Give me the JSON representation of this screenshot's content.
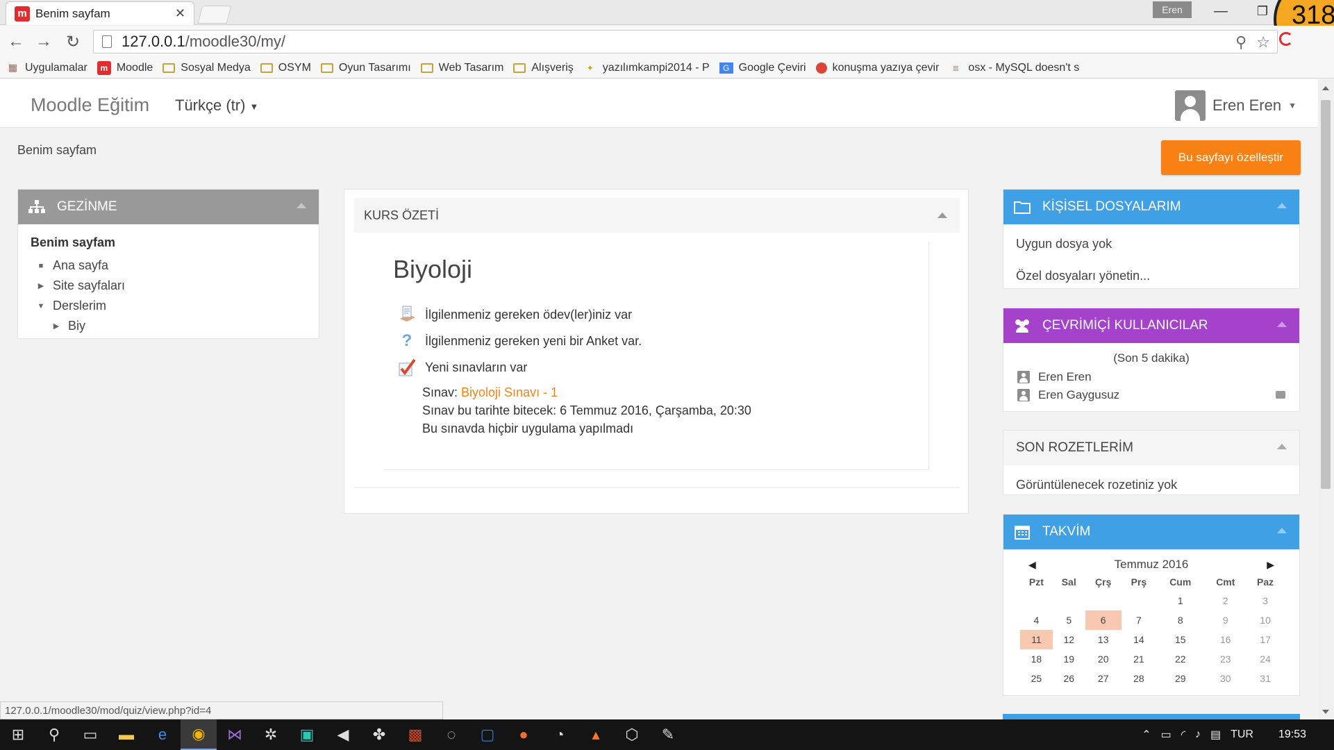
{
  "browser": {
    "tab_title": "Benim sayfam",
    "tab_close": "✕",
    "favicon_letter": "m",
    "profile_label": "Eren",
    "counter_badge": "318",
    "url_host": "127.0.0.1",
    "url_path": "/moodle30/my/",
    "bookmarks": [
      {
        "label": "Uygulamalar",
        "icon": "apps-grid-icon"
      },
      {
        "label": "Moodle",
        "icon": "moodle-icon"
      },
      {
        "label": "Sosyal Medya",
        "icon": "folder-icon"
      },
      {
        "label": "OSYM",
        "icon": "folder-icon"
      },
      {
        "label": "Oyun Tasarımı",
        "icon": "folder-icon"
      },
      {
        "label": "Web Tasarım",
        "icon": "folder-icon"
      },
      {
        "label": "Alışveriş",
        "icon": "folder-icon"
      },
      {
        "label": "yazılımkampi2014 - P",
        "icon": "bee-icon"
      },
      {
        "label": "Google Çeviri",
        "icon": "translate-icon"
      },
      {
        "label": "konuşma yazıya çevir",
        "icon": "chrome-icon"
      },
      {
        "label": "osx - MySQL doesn't s",
        "icon": "stack-icon"
      }
    ]
  },
  "navbar": {
    "brand": "Moodle Eğitim",
    "language": "Türkçe (tr)",
    "user_name": "Eren Eren"
  },
  "page": {
    "breadcrumb": "Benim sayfam",
    "customize_button": "Bu sayfayı özelleştir"
  },
  "nav_block": {
    "title": "GEZİNME",
    "root": "Benim sayfam",
    "items": [
      {
        "label": "Ana sayfa",
        "marker": "■"
      },
      {
        "label": "Site sayfaları",
        "marker": "▶"
      },
      {
        "label": "Derslerim",
        "marker": "▼"
      },
      {
        "label": "Biy",
        "marker": "▶"
      }
    ]
  },
  "course_block": {
    "title": "KURS ÖZETİ",
    "course_name": "Biyoloji",
    "notices": [
      {
        "text": "İlgilenmeniz gereken ödev(ler)iniz var",
        "icon": "assignment-icon"
      },
      {
        "text": "İlgilenmeniz gereken yeni bir Anket var.",
        "icon": "question-icon"
      },
      {
        "text": "Yeni sınavların var",
        "icon": "quiz-check-icon"
      }
    ],
    "quiz_prefix": "Sınav: ",
    "quiz_link": "Biyoloji Sınavı - 1",
    "quiz_deadline": "Sınav bu tarihte bitecek: 6 Temmuz 2016, Çarşamba, 20:30",
    "quiz_attempts": "Bu sınavda hiçbir uygulama yapılmadı"
  },
  "files_block": {
    "title": "KİŞİSEL DOSYALARIM",
    "empty": "Uygun dosya yok",
    "manage": "Özel dosyaları yönetin..."
  },
  "online_block": {
    "title": "ÇEVRİMİÇİ KULLANICILAR",
    "subtitle": "(Son 5 dakika)",
    "users": [
      "Eren Eren",
      "Eren Gaygusuz"
    ]
  },
  "badges_block": {
    "title": "SON ROZETLERİM",
    "empty": "Görüntülenecek rozetiniz yok"
  },
  "calendar": {
    "title": "TAKVİM",
    "month": "Temmuz 2016",
    "prev": "◀",
    "next": "▶",
    "weekdays": [
      "Pzt",
      "Sal",
      "Çrş",
      "Prş",
      "Cum",
      "Cmt",
      "Paz"
    ],
    "weeks": [
      [
        "",
        "",
        "",
        "",
        "1",
        "2",
        "3"
      ],
      [
        "4",
        "5",
        "6",
        "7",
        "8",
        "9",
        "10"
      ],
      [
        "11",
        "12",
        "13",
        "14",
        "15",
        "16",
        "17"
      ],
      [
        "18",
        "19",
        "20",
        "21",
        "22",
        "23",
        "24"
      ],
      [
        "25",
        "26",
        "27",
        "28",
        "29",
        "30",
        "31"
      ]
    ],
    "event_day": "6",
    "today": "11"
  },
  "status_url": "127.0.0.1/moodle30/mod/quiz/view.php?id=4",
  "taskbar": {
    "language": "TUR",
    "time": "19:53"
  },
  "colors": {
    "accent_orange": "#f98012",
    "block_blue": "#3fa0e6",
    "block_purple": "#a542cc",
    "nav_gray": "#999999"
  }
}
